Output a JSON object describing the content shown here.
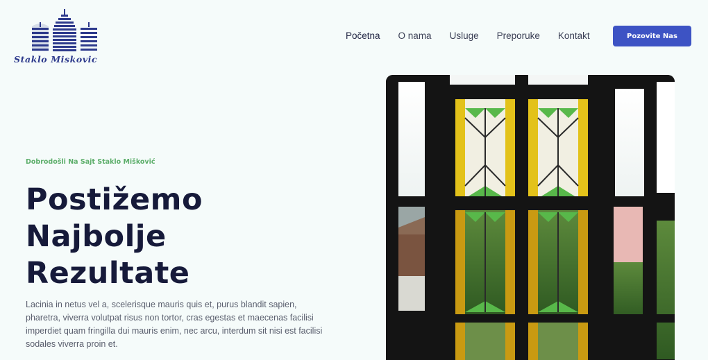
{
  "brand": {
    "name": "Staklo Miskovic",
    "logo_icon": "city-buildings-icon",
    "color": "#2d3a8c"
  },
  "nav": {
    "items": [
      {
        "label": "Početna"
      },
      {
        "label": "O nama"
      },
      {
        "label": "Usluge"
      },
      {
        "label": "Preporuke"
      },
      {
        "label": "Kontakt"
      }
    ],
    "cta_label": "Pozovite Nas"
  },
  "hero": {
    "eyebrow": "Dobrodošli Na Sajt Staklo Mišković",
    "title_lines": [
      "Postižemo",
      "Najbolje",
      "Rezultate"
    ],
    "lead": "Lacinia in netus vel a, scelerisque mauris quis et, purus blandit sapien, pharetra, viverra volutpat risus non tortor, cras egestas et maecenas facilisi imperdiet quam fringilla dui mauris enim, nec arcu, interdum sit nisi est facilisi sodales viverra proin et.",
    "image_icon": "stained-glass-window-image"
  },
  "colors": {
    "background": "#f5fbfa",
    "accent": "#3d53c4",
    "eyebrow": "#5cae6a",
    "heading": "#161a3a"
  }
}
